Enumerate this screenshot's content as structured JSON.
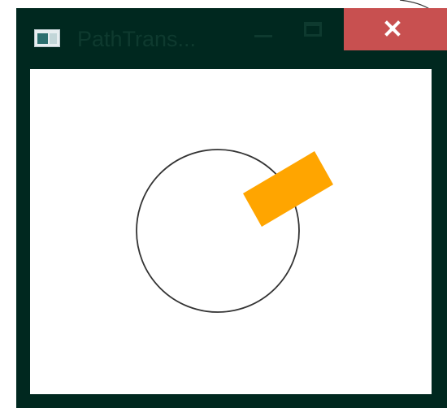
{
  "window": {
    "title": "PathTrans...",
    "frame_color": "#00281f",
    "close_color": "#c85050",
    "buttons": {
      "minimize_icon": "minimize-icon",
      "maximize_icon": "maximize-icon",
      "close_icon": "close-icon"
    }
  },
  "scene": {
    "circle_stroke": "#333333",
    "rectangle_fill": "#ffa500"
  }
}
